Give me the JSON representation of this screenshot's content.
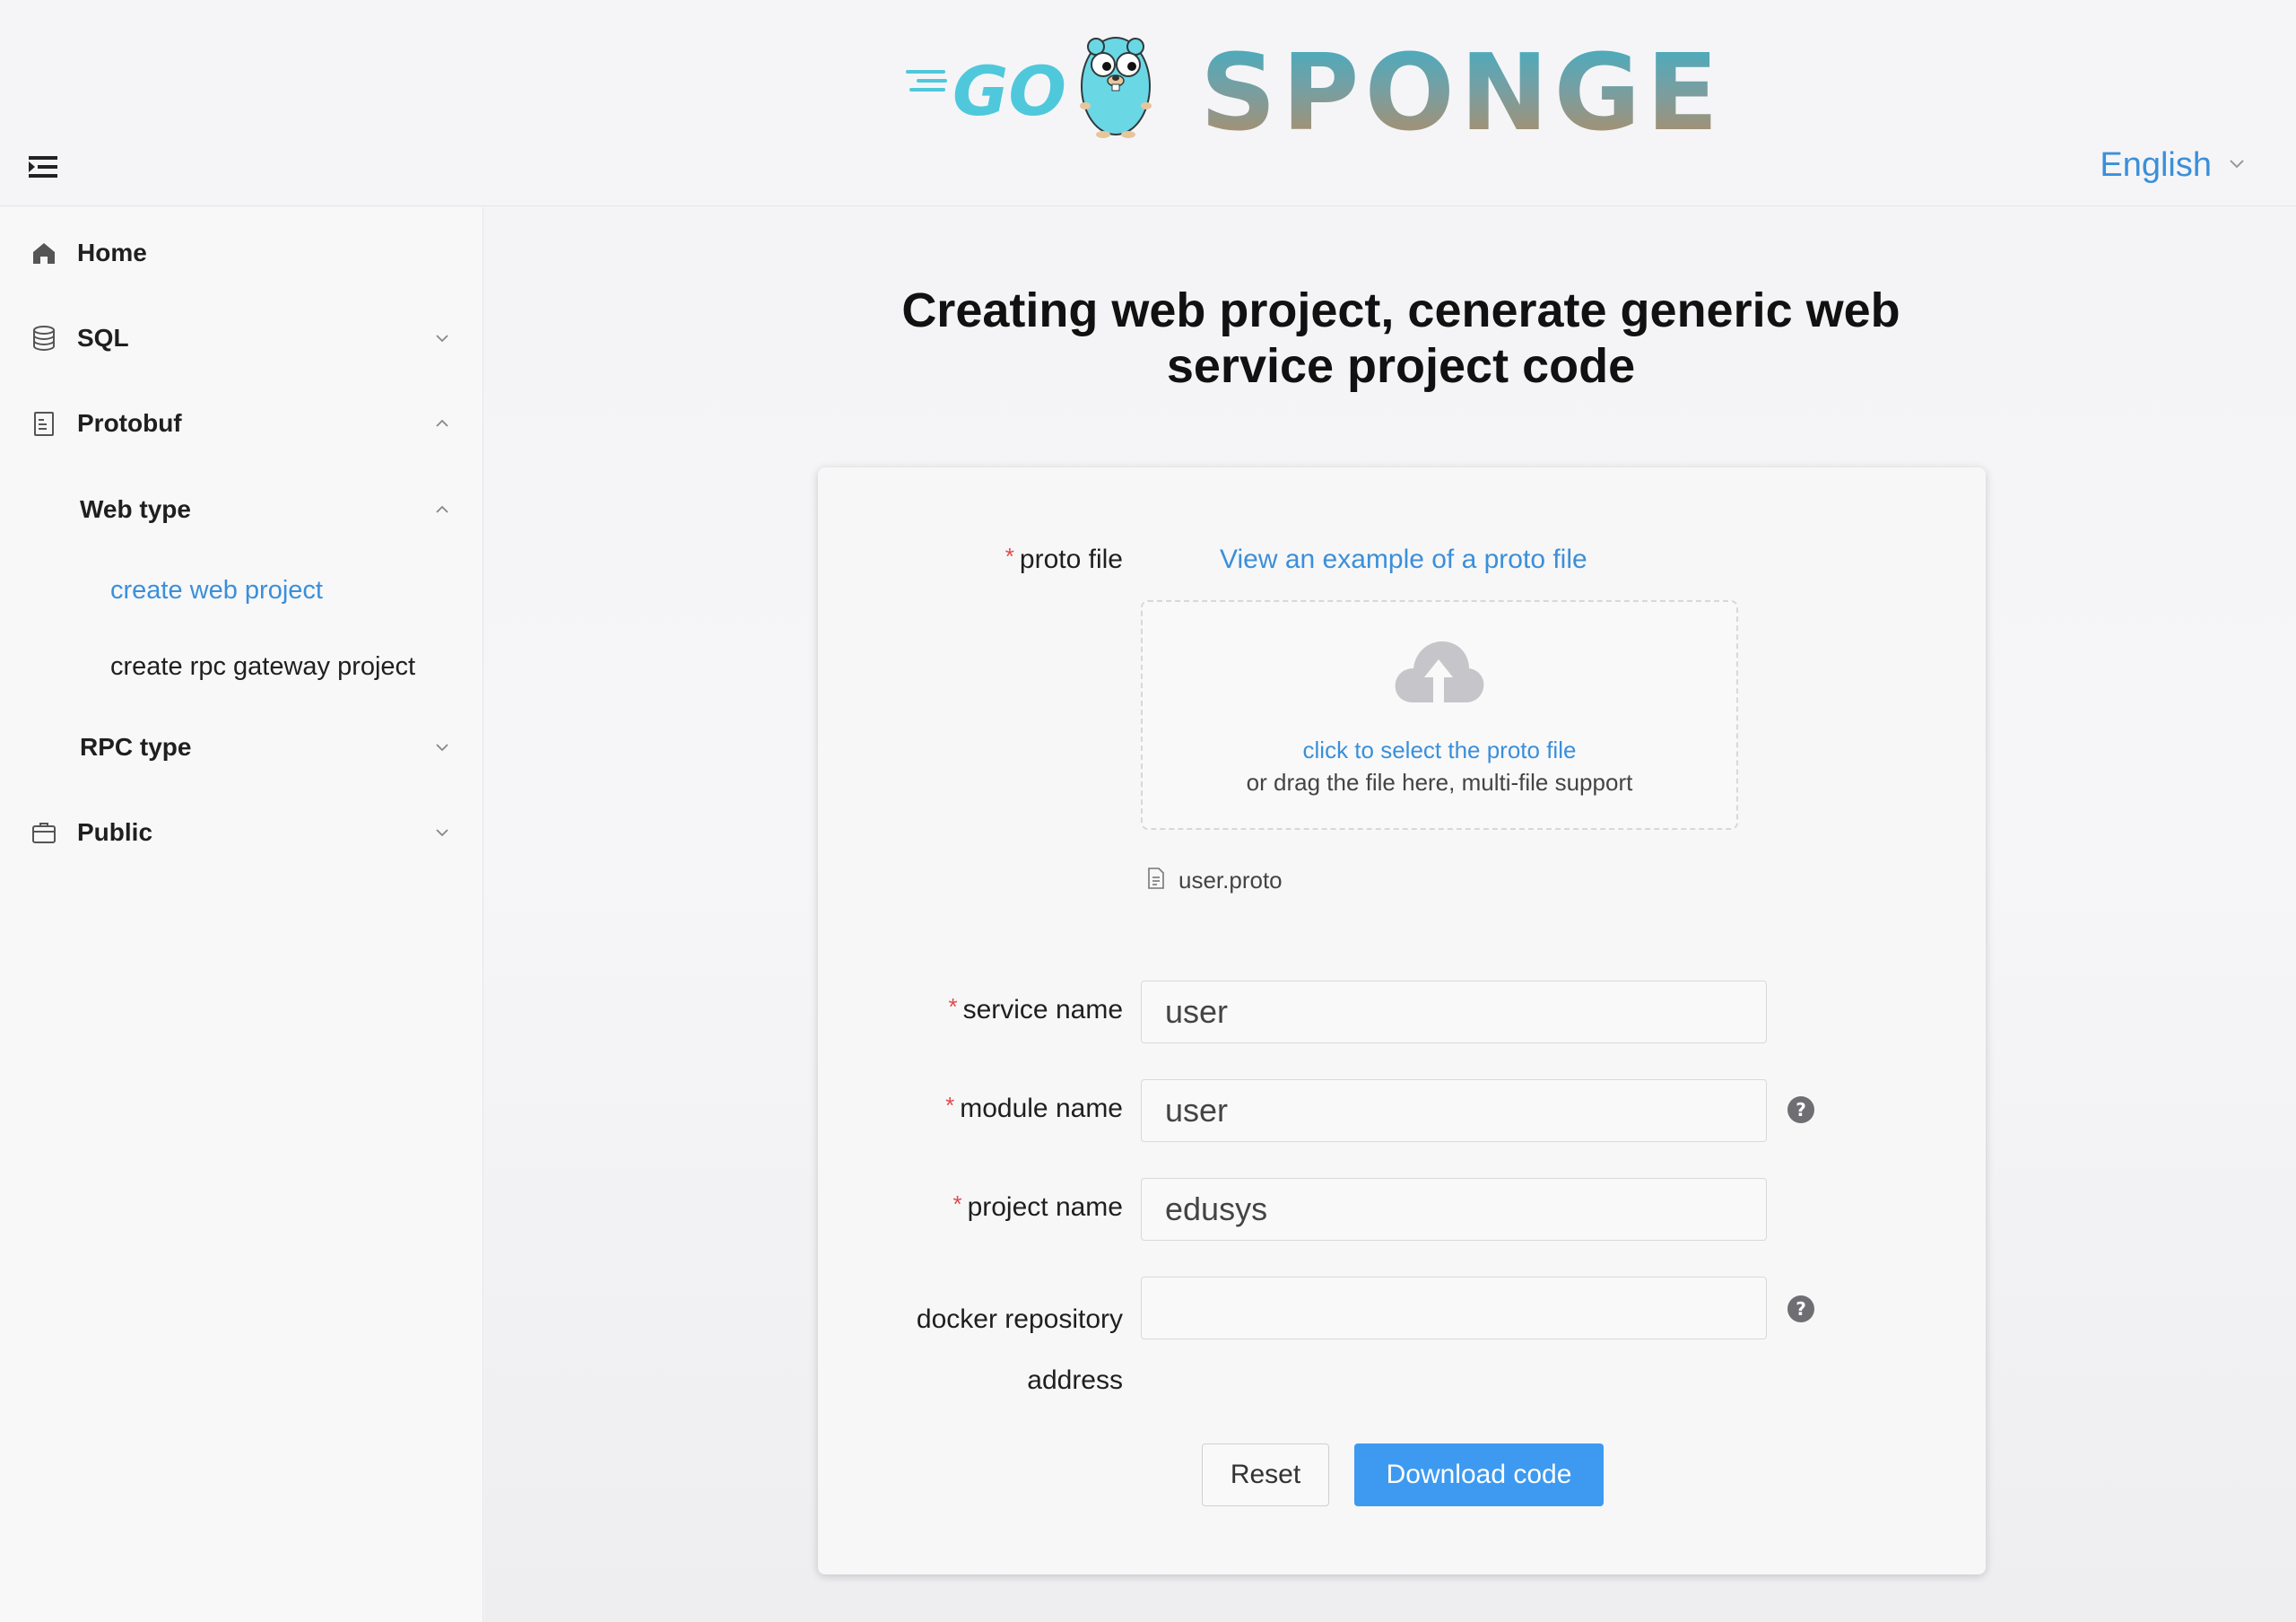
{
  "header": {
    "logo_go": "GO",
    "logo_text": "SPONGE",
    "language": "English"
  },
  "sidebar": {
    "items": [
      {
        "label": "Home",
        "icon": "home-icon"
      },
      {
        "label": "SQL",
        "icon": "database-icon"
      },
      {
        "label": "Protobuf",
        "icon": "document-icon"
      },
      {
        "label": "Web type"
      },
      {
        "label": "create web project",
        "active": true
      },
      {
        "label": "create rpc gateway project"
      },
      {
        "label": "RPC type"
      },
      {
        "label": "Public",
        "icon": "briefcase-icon"
      }
    ]
  },
  "main": {
    "title": "Creating web project, cenerate generic web service project code"
  },
  "form": {
    "proto_file_label": "proto file",
    "example_link": "View an example of a proto file",
    "upload_link": "click to select the proto file",
    "upload_hint": "or drag the file here, multi-file support",
    "uploaded_file": "user.proto",
    "service_name_label": "service name",
    "service_name_value": "user",
    "module_name_label": "module name",
    "module_name_value": "user",
    "project_name_label": "project name",
    "project_name_value": "edusys",
    "docker_label_line1": "docker repository",
    "docker_label_line2": "address",
    "docker_value": "",
    "reset_label": "Reset",
    "download_label": "Download code",
    "required_mark": "*"
  },
  "colors": {
    "accent": "#3b8fd9",
    "primary_button": "#3d9af0",
    "required": "#e24a4a"
  }
}
